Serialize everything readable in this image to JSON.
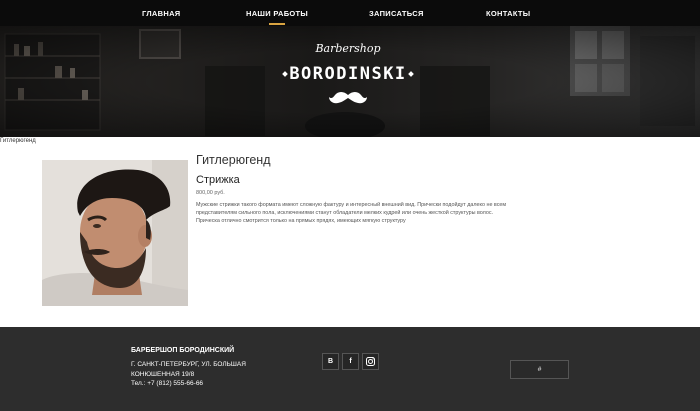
{
  "nav": {
    "items": [
      {
        "label": "ГЛАВНАЯ"
      },
      {
        "label": "НАШИ РАБОТЫ",
        "active": true
      },
      {
        "label": "ЗАПИСАТЬСЯ"
      },
      {
        "label": "КОНТАКТЫ"
      }
    ],
    "accent_color": "#d9a441"
  },
  "hero": {
    "logo_script": "Barbershop",
    "logo_main": "BORODINSKI"
  },
  "breadcrumb": "Гитлерюгенд",
  "content": {
    "title": "Гитлерюгенд",
    "service": "Стрижка",
    "price": "800,00 руб.",
    "description": "Мужские стрижки такого формата имеют сложную фактуру и интересный внешний вид. Прически подойдут далеко не всем представителям сильного пола, исключениями станут обладатели мелких кудрей или очень жесткой структуры волос. Прическа отлично смотрится только на прямых прядях, имеющих мягкую структуру"
  },
  "footer": {
    "brand": "БАРБЕРШОП БОРОДИНСКИЙ",
    "address": "Г. САНКТ-ПЕТЕРБУРГ, УЛ. БОЛЬШАЯ КОНЮШЕННАЯ 19/8",
    "phone": "Тел.: +7 (812) 555-66-66",
    "socials": [
      {
        "label": "В",
        "icon": "vk-icon"
      },
      {
        "label": "f",
        "icon": "facebook-icon"
      },
      {
        "label": "",
        "icon": "instagram-icon"
      }
    ],
    "button_label": "#"
  }
}
